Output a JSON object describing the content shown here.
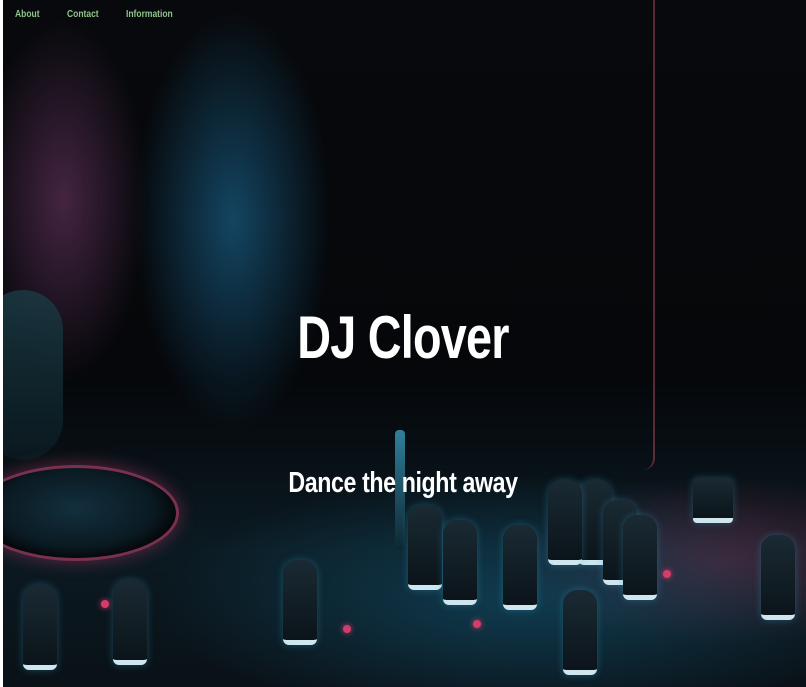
{
  "nav": {
    "items": [
      {
        "label": "About"
      },
      {
        "label": "Contact"
      },
      {
        "label": "Information"
      }
    ]
  },
  "hero": {
    "title": "DJ Clover",
    "tagline": "Dance the night away",
    "background_image": "dj-mixer-photo",
    "colors": {
      "nav_link": "#8fc28a",
      "heading": "#ffffff"
    }
  }
}
